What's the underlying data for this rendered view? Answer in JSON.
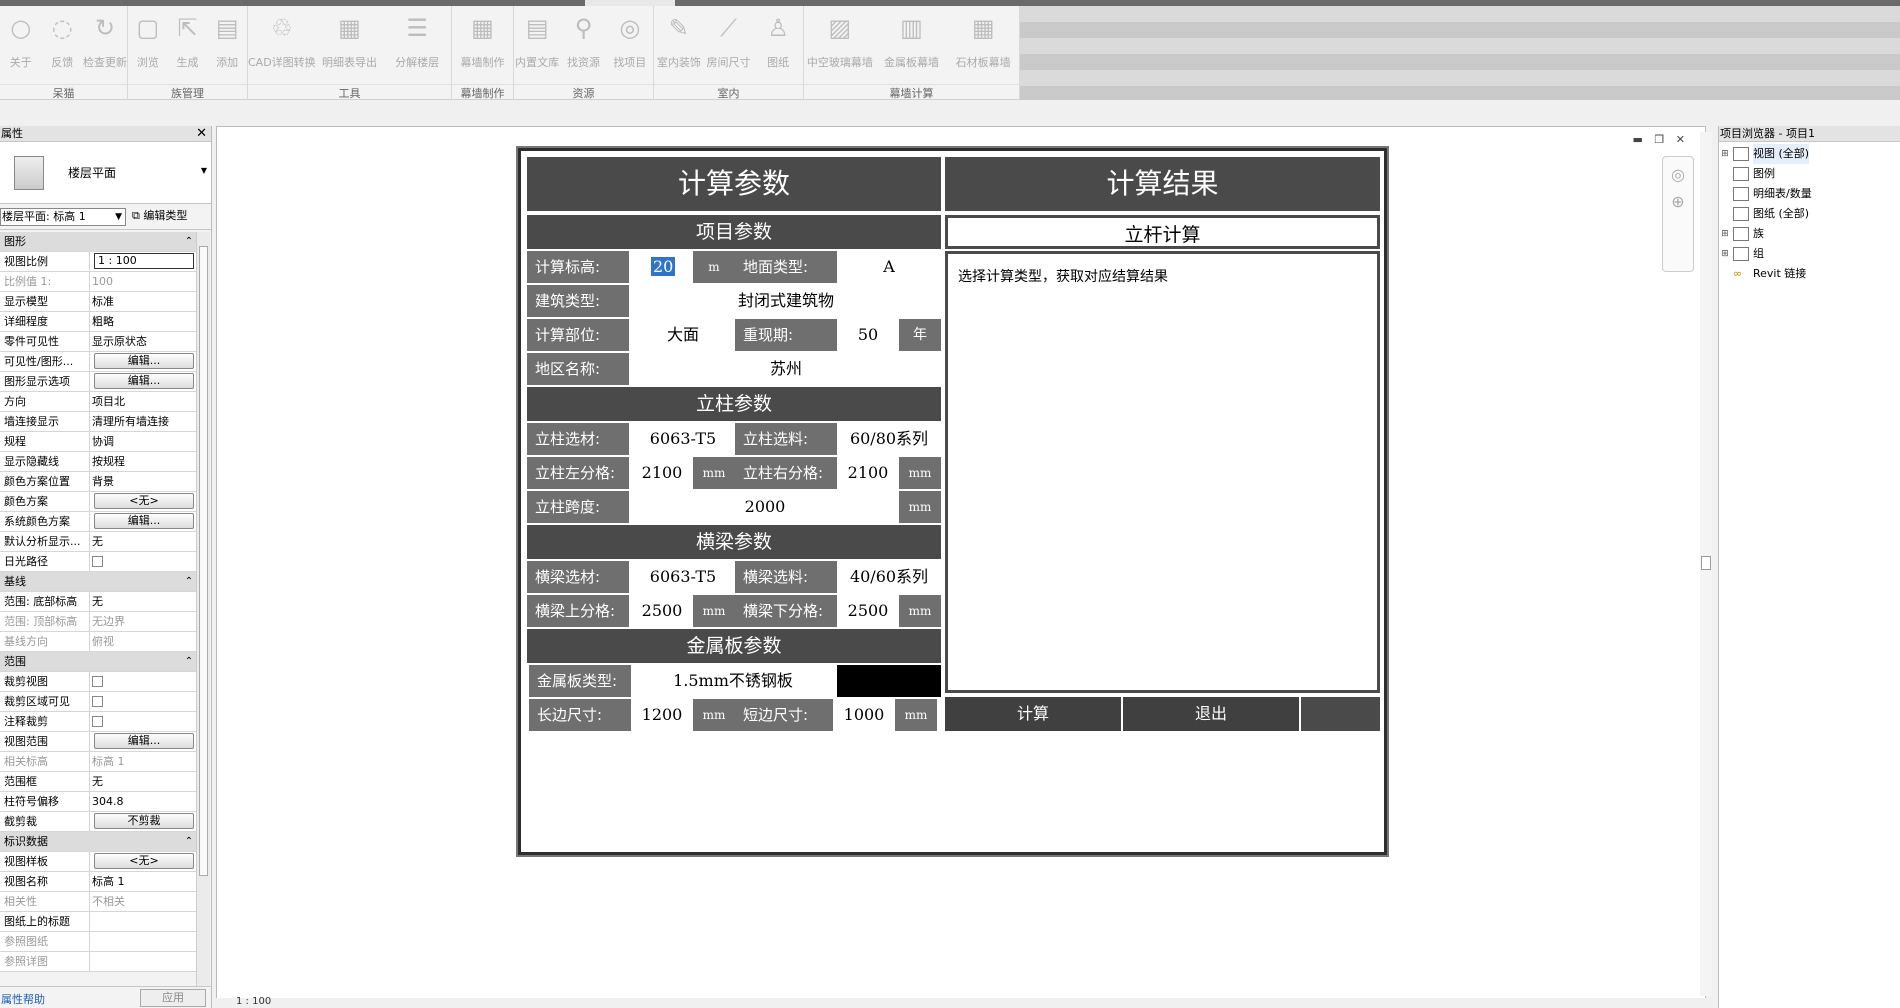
{
  "ribbon": {
    "groups": [
      {
        "name": "呆猫",
        "buttons": [
          {
            "icon": "bulb-icon",
            "label": "关于"
          },
          {
            "icon": "chat-icon",
            "label": "反馈"
          },
          {
            "icon": "refresh-icon",
            "label": "检查更新"
          }
        ]
      },
      {
        "name": "族管理",
        "buttons": [
          {
            "icon": "browse-icon",
            "label": "浏览"
          },
          {
            "icon": "export-icon",
            "label": "生成"
          },
          {
            "icon": "add-icon",
            "label": "添加"
          }
        ]
      },
      {
        "name": "工具",
        "buttons": [
          {
            "icon": "recycle-icon",
            "label": "CAD详图转换"
          },
          {
            "icon": "table-icon",
            "label": "明细表导出"
          },
          {
            "icon": "layers-icon",
            "label": "分解楼层"
          }
        ]
      },
      {
        "name": "幕墙制作",
        "buttons": [
          {
            "icon": "curtain-wall-icon",
            "label": "幕墙制作"
          }
        ]
      },
      {
        "name": "资源",
        "buttons": [
          {
            "icon": "document-icon",
            "label": "内置文库"
          },
          {
            "icon": "search-icon",
            "label": "找资源"
          },
          {
            "icon": "ub-icon",
            "label": "找项目"
          }
        ]
      },
      {
        "name": "室内",
        "buttons": [
          {
            "icon": "brush-icon",
            "label": "室内装饰"
          },
          {
            "icon": "ruler-icon",
            "label": "房间尺寸"
          },
          {
            "icon": "figure-icon",
            "label": "图纸"
          }
        ]
      },
      {
        "name": "幕墙计算",
        "buttons": [
          {
            "icon": "glass-wall-icon",
            "label": "中空玻璃幕墙"
          },
          {
            "icon": "metal-panel-icon",
            "label": "金属板幕墙"
          },
          {
            "icon": "stone-panel-icon",
            "label": "石材板幕墙"
          }
        ]
      }
    ]
  },
  "properties": {
    "title": "属性",
    "type_name": "楼层平面",
    "floor_selector": "楼层平面: 标高 1",
    "edit_type": "编辑类型",
    "rows": [
      {
        "kind": "section",
        "k": "图形"
      },
      {
        "k": "视图比例",
        "v": "1 : 100",
        "box": true
      },
      {
        "k": "比例值 1:",
        "v": "100",
        "gray": true
      },
      {
        "k": "显示模型",
        "v": "标准"
      },
      {
        "k": "详细程度",
        "v": "粗略"
      },
      {
        "k": "零件可见性",
        "v": "显示原状态"
      },
      {
        "k": "可见性/图形...",
        "v": "编辑...",
        "btn": true
      },
      {
        "k": "图形显示选项",
        "v": "编辑...",
        "btn": true
      },
      {
        "k": "方向",
        "v": "项目北"
      },
      {
        "k": "墙连接显示",
        "v": "清理所有墙连接"
      },
      {
        "k": "规程",
        "v": "协调"
      },
      {
        "k": "显示隐藏线",
        "v": "按规程"
      },
      {
        "k": "颜色方案位置",
        "v": "背景"
      },
      {
        "k": "颜色方案",
        "v": "<无>",
        "btn": true
      },
      {
        "k": "系统颜色方案",
        "v": "编辑...",
        "btn": true
      },
      {
        "k": "默认分析显示...",
        "v": "无"
      },
      {
        "k": "日光路径",
        "v": "",
        "chk": true
      },
      {
        "kind": "section",
        "k": "基线"
      },
      {
        "k": "范围: 底部标高",
        "v": "无"
      },
      {
        "k": "范围: 顶部标高",
        "v": "无边界",
        "gray": true
      },
      {
        "k": "基线方向",
        "v": "俯视",
        "gray": true
      },
      {
        "kind": "section",
        "k": "范围"
      },
      {
        "k": "裁剪视图",
        "v": "",
        "chk": true
      },
      {
        "k": "裁剪区域可见",
        "v": "",
        "chk": true
      },
      {
        "k": "注释裁剪",
        "v": "",
        "chk": true
      },
      {
        "k": "视图范围",
        "v": "编辑...",
        "btn": true
      },
      {
        "k": "相关标高",
        "v": "标高 1",
        "gray": true
      },
      {
        "k": "范围框",
        "v": "无"
      },
      {
        "k": "柱符号偏移",
        "v": "304.8"
      },
      {
        "k": "截剪裁",
        "v": "不剪裁",
        "btn": true
      },
      {
        "kind": "section",
        "k": "标识数据"
      },
      {
        "k": "视图样板",
        "v": "<无>",
        "btn": true
      },
      {
        "k": "视图名称",
        "v": "标高 1"
      },
      {
        "k": "相关性",
        "v": "不相关",
        "gray": true
      },
      {
        "k": "图纸上的标题",
        "v": ""
      },
      {
        "k": "参照图纸",
        "v": "",
        "gray": true
      },
      {
        "k": "参照详图",
        "v": "",
        "gray": true
      }
    ],
    "help": "属性帮助",
    "apply": "应用"
  },
  "browser": {
    "title": "项目浏览器 - 项目1",
    "nodes": [
      {
        "exp": "⊞",
        "label": "视图 (全部)",
        "selected": true
      },
      {
        "exp": "",
        "label": "图例"
      },
      {
        "exp": "",
        "label": "明细表/数量"
      },
      {
        "exp": "",
        "label": "图纸 (全部)"
      },
      {
        "exp": "⊞",
        "label": "族"
      },
      {
        "exp": "⊞",
        "label": "组"
      },
      {
        "exp": "",
        "label": "Revit 链接",
        "link": true
      }
    ]
  },
  "statusbar": {
    "scale": "1 : 100"
  },
  "dialog": {
    "left_header": "计算参数",
    "right_header": "计算结果",
    "project_section": "项目参数",
    "calc_height_label": "计算标高:",
    "calc_height_value": "20",
    "calc_height_unit": "m",
    "ground_type_label": "地面类型:",
    "ground_type_value": "A",
    "building_type_label": "建筑类型:",
    "building_type_value": "封闭式建筑物",
    "calc_part_label": "计算部位:",
    "calc_part_value": "大面",
    "return_period_label": "重现期:",
    "return_period_value": "50",
    "return_period_unit": "年",
    "region_label": "地区名称:",
    "region_value": "苏州",
    "column_section": "立柱参数",
    "col_material_label": "立柱选材:",
    "col_material_value": "6063-T5",
    "col_profile_label": "立柱选料:",
    "col_profile_value": "60/80系列",
    "col_left_label": "立柱左分格:",
    "col_left_value": "2100",
    "col_right_label": "立柱右分格:",
    "col_right_value": "2100",
    "col_span_label": "立柱跨度:",
    "col_span_value": "2000",
    "mm": "mm",
    "beam_section": "横梁参数",
    "beam_material_label": "横梁选材:",
    "beam_material_value": "6063-T5",
    "beam_profile_label": "横梁选料:",
    "beam_profile_value": "40/60系列",
    "beam_top_label": "横梁上分格:",
    "beam_top_value": "2500",
    "beam_bottom_label": "横梁下分格:",
    "beam_bottom_value": "2500",
    "panel_section": "金属板参数",
    "panel_type_label": "金属板类型:",
    "panel_type_value": "1.5mm不锈钢板",
    "long_label": "长边尺寸:",
    "long_value": "1200",
    "short_label": "短边尺寸:",
    "short_value": "1000",
    "result_section": "立杆计算",
    "result_text": "选择计算类型，获取对应结算结果",
    "calc_button": "计算",
    "exit_button": "退出"
  }
}
